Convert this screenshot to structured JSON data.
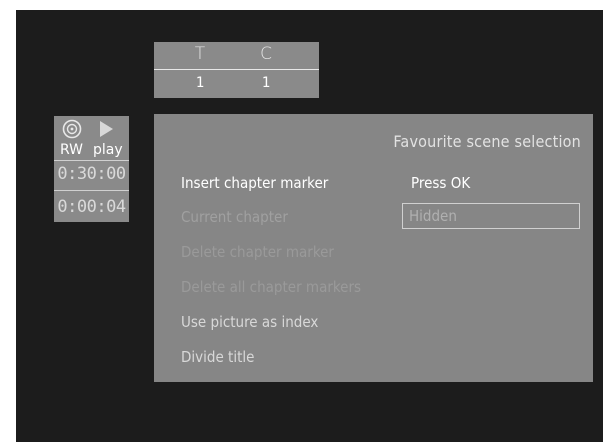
{
  "timecode": {
    "title_header": "T",
    "chapter_header": "C",
    "title_value": "1",
    "chapter_value": "1"
  },
  "status": {
    "disc_icon": "disc-rw-icon",
    "play_icon": "play-icon",
    "disc_label": "RW",
    "mode_label": "play",
    "total_time": "0:30:00",
    "elapsed_time": "0:00:04"
  },
  "menu": {
    "title": "Favourite scene selection",
    "items": [
      {
        "label": "Insert chapter marker",
        "value": "Press OK",
        "state": "active"
      },
      {
        "label": "Current chapter",
        "value": "Hidden",
        "state": "dim"
      },
      {
        "label": "Delete chapter marker",
        "state": "faint"
      },
      {
        "label": "Delete all chapter markers",
        "state": "faint"
      },
      {
        "label": "Use picture as index",
        "state": "normal"
      },
      {
        "label": "Divide title",
        "state": "normal"
      }
    ]
  },
  "colors": {
    "background": "#1c1c1c",
    "panel": "#868686",
    "text_highlight": "#ffffff"
  }
}
